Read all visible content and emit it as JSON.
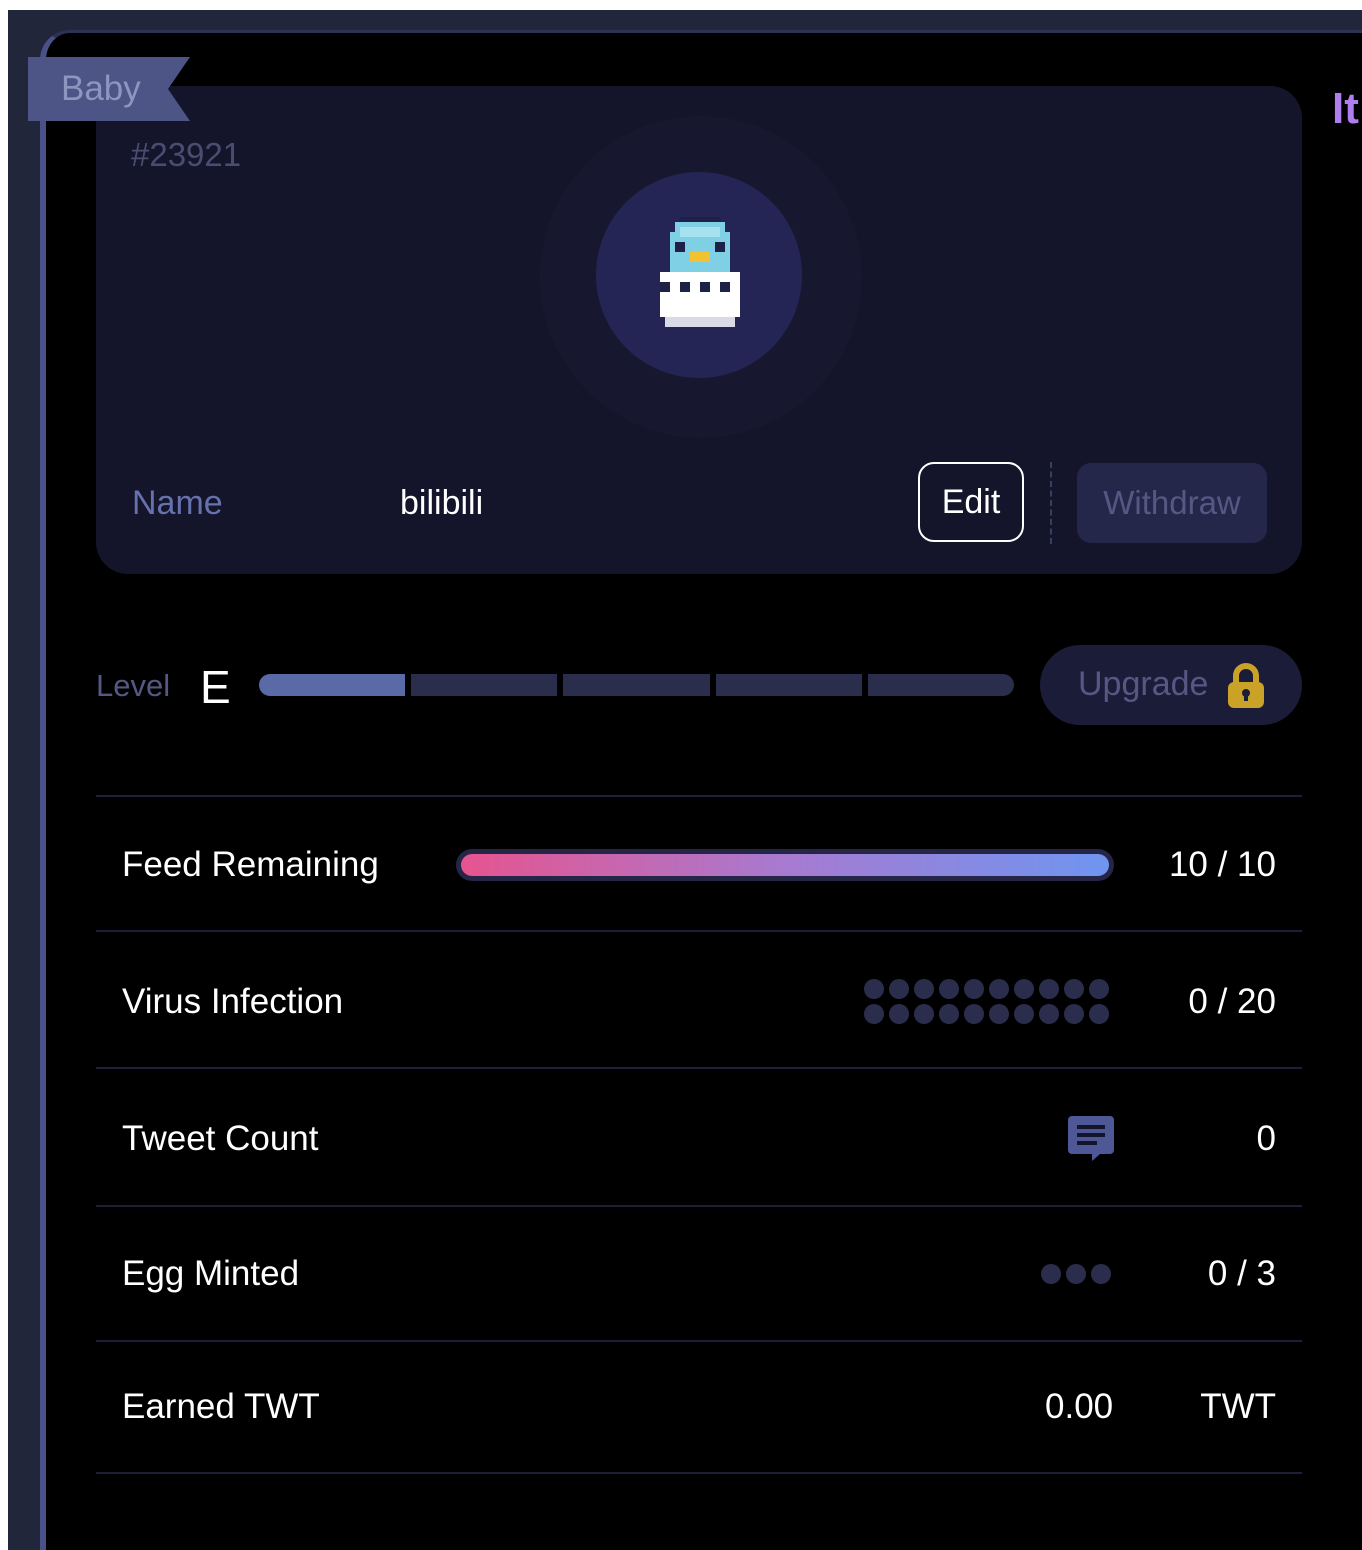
{
  "side_title": "It",
  "card": {
    "badge": "Baby",
    "token_id": "#23921",
    "name_label": "Name",
    "name_value": "bilibili",
    "edit_label": "Edit",
    "withdraw_label": "Withdraw"
  },
  "level": {
    "label": "Level",
    "value": "E",
    "segments_total": 5,
    "segments_filled": 1,
    "upgrade_label": "Upgrade",
    "upgrade_icon": "lock-icon"
  },
  "stats": {
    "feed": {
      "label": "Feed Remaining",
      "value": "10 / 10",
      "fraction": 1.0
    },
    "virus": {
      "label": "Virus Infection",
      "value": "0 / 20",
      "count": 0,
      "total": 20
    },
    "tweet": {
      "label": "Tweet Count",
      "value": "0",
      "icon": "tweet-icon"
    },
    "egg": {
      "label": "Egg Minted",
      "value": "0 / 3",
      "count": 0,
      "total": 3
    },
    "earned": {
      "label": "Earned TWT",
      "amount": "0.00",
      "unit": "TWT"
    }
  },
  "colors": {
    "accent": "#b07fef",
    "feed_gradient_start": "#e6548f",
    "feed_gradient_end": "#6f95f0",
    "lock": "#c9a227"
  }
}
